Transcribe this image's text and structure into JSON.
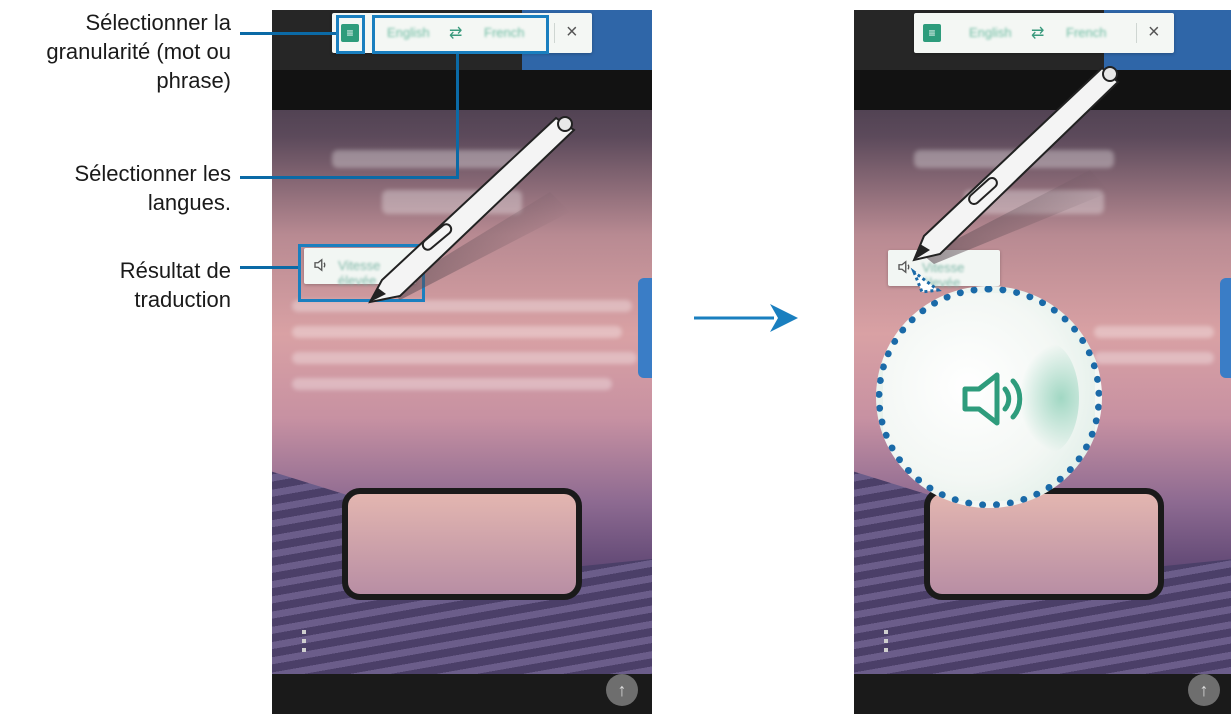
{
  "annotations": [
    {
      "lines": [
        "Sélectionner la",
        "granularité (mot ou",
        "phrase)"
      ]
    },
    {
      "lines": [
        "Sélectionner les",
        "langues."
      ]
    },
    {
      "lines": [
        "Résultat de",
        "traduction"
      ]
    }
  ],
  "toolbar": {
    "source_language": "English",
    "target_language": "French",
    "close_icon": "close-icon",
    "swap_icon": "swap-arrows-icon",
    "granularity_icon": "word-mode-icon"
  },
  "result": {
    "speaker_icon": "speaker-icon",
    "translated_text": "Vitesse élevée"
  },
  "colors": {
    "callout_line": "#0b6aa6",
    "highlight": "#1a7fbf",
    "accent": "#2e9c7c",
    "arrow": "#1a7fbf"
  },
  "icons": {
    "flow_arrow": "right-arrow-icon",
    "scroll_up": "arrow-up-icon",
    "pen": "s-pen-icon"
  }
}
